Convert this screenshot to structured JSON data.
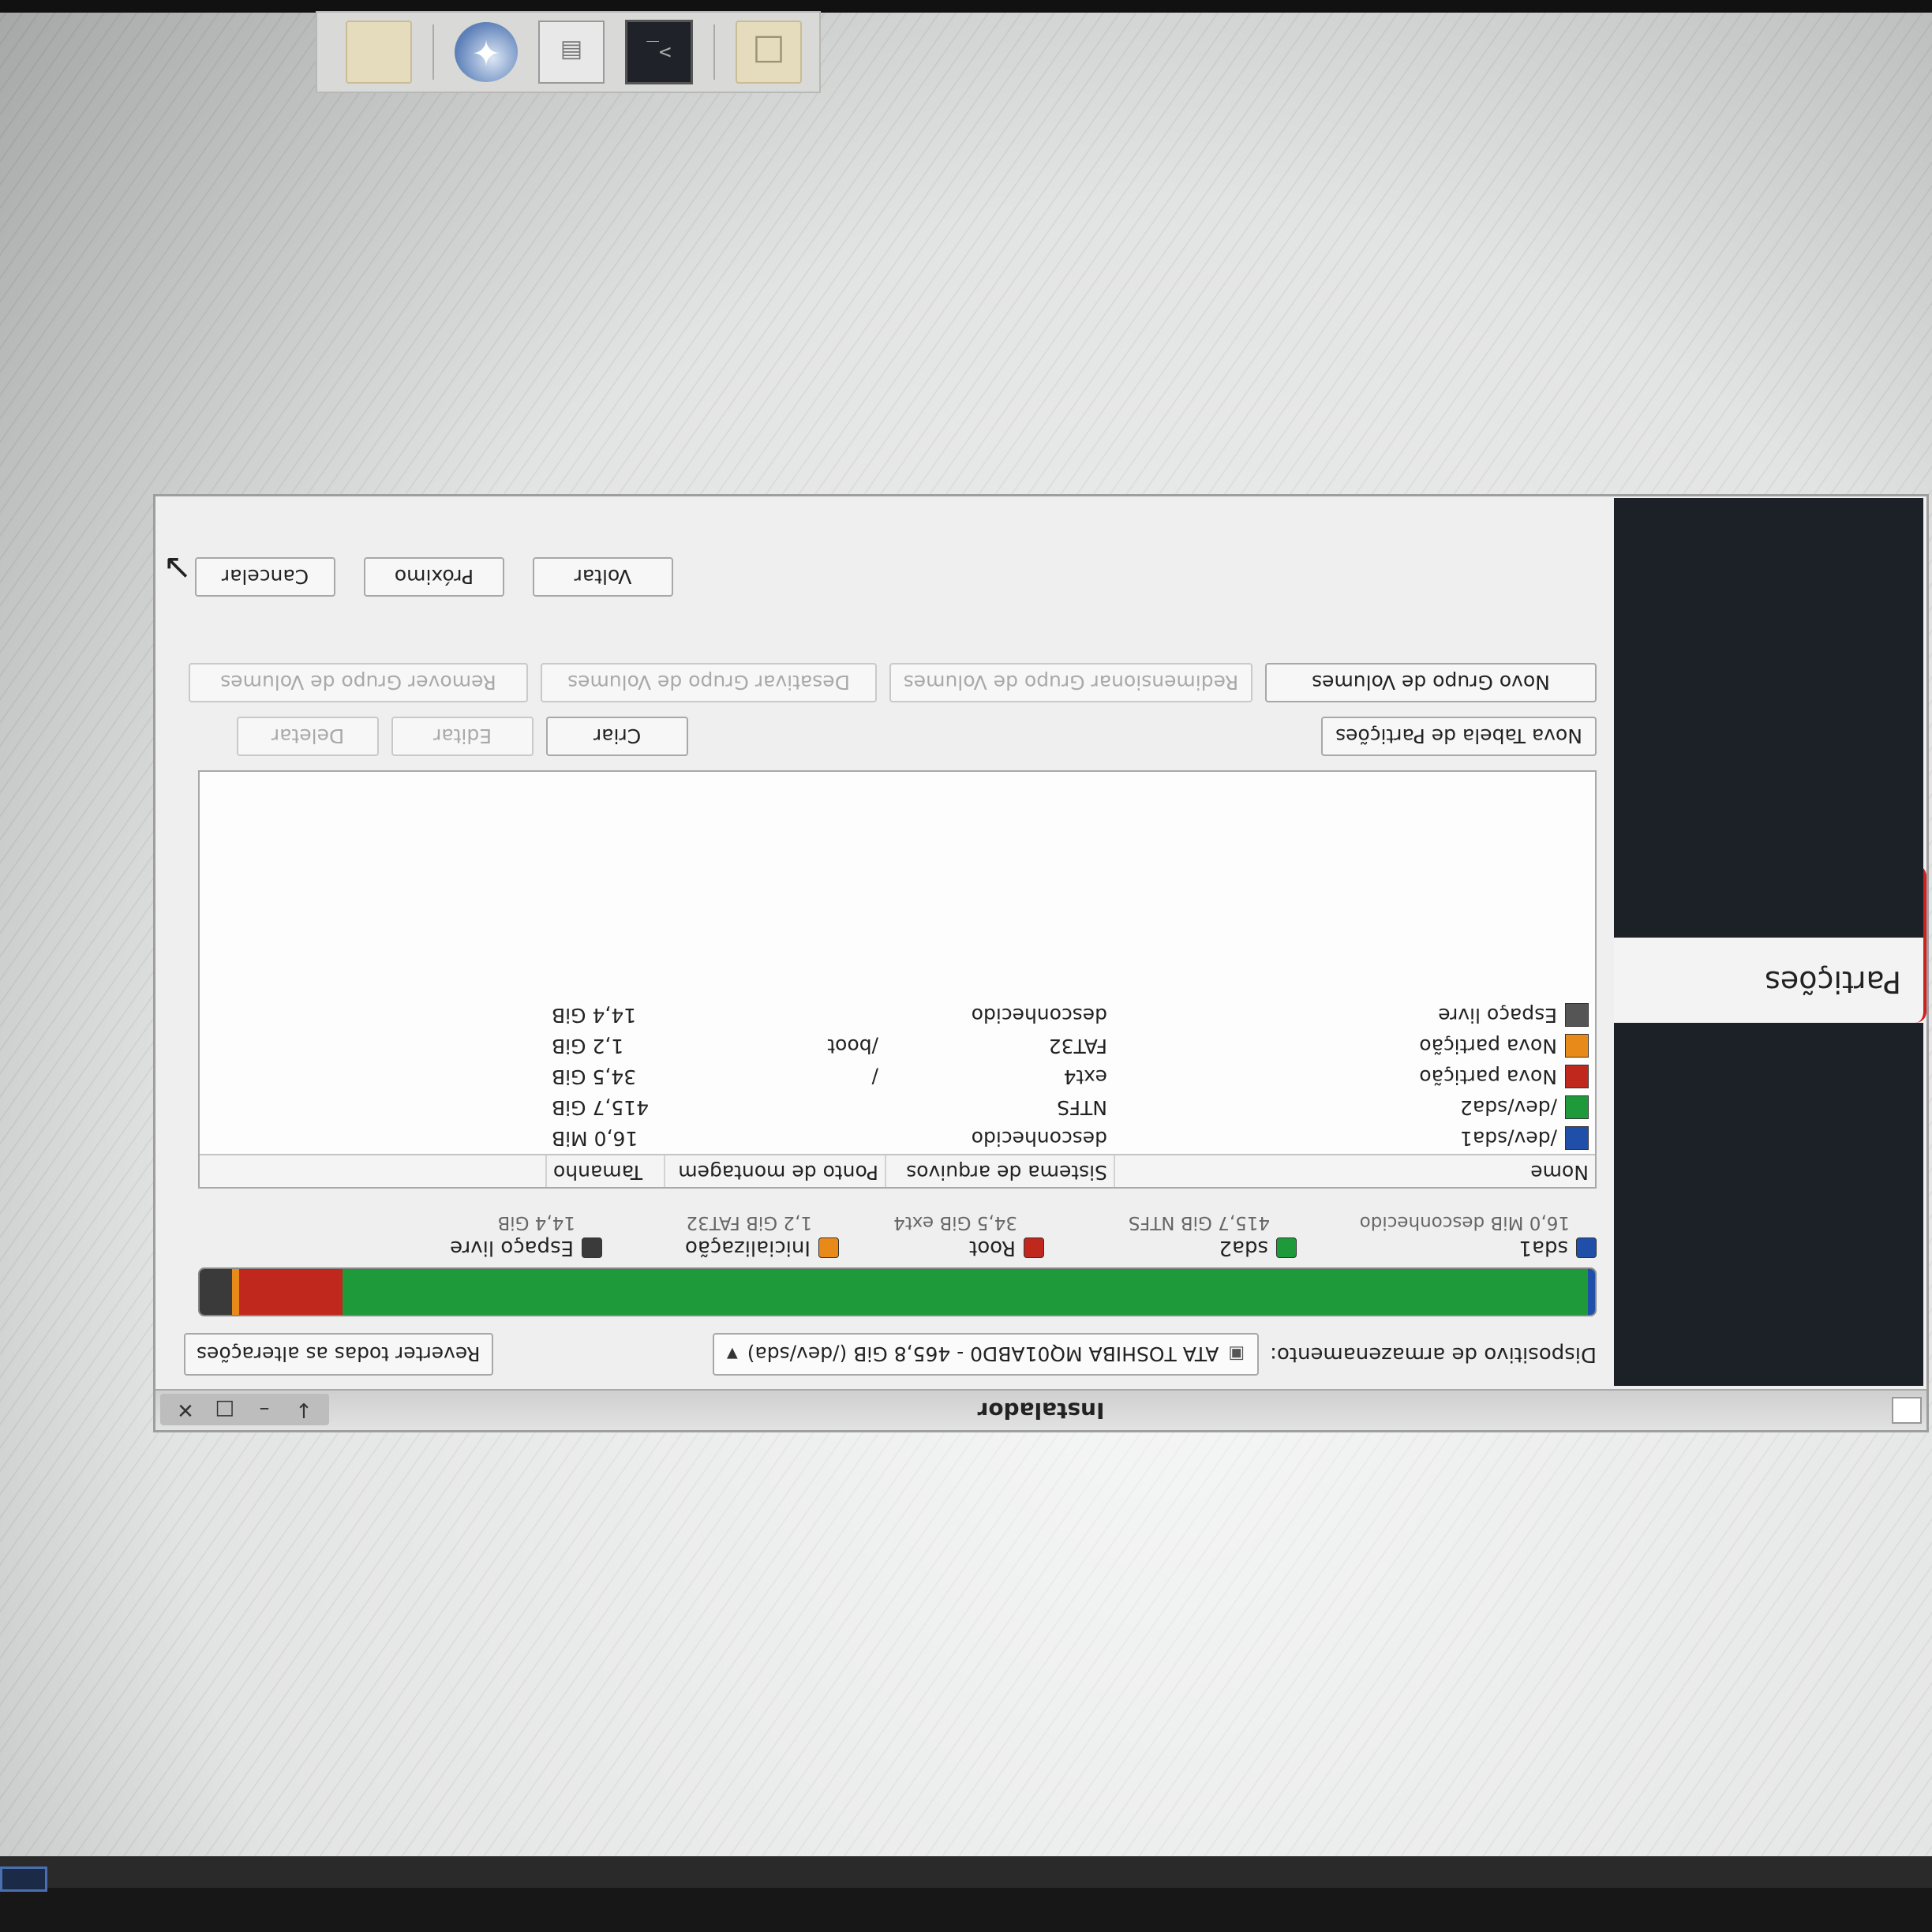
{
  "window": {
    "title": "Instalador"
  },
  "sidebar": {
    "title": "Partições"
  },
  "device": {
    "label": "Dispositivo de armazenamento:",
    "selected": "ATA TOSHIBA MQ01ABD0 - 465,8 GiB (/dev/sda)",
    "revert_label": "Reverter todas as alterações"
  },
  "usage": [
    {
      "name": "sda1",
      "fraction": 3e-05,
      "color": "#1f4fa8"
    },
    {
      "name": "sda2",
      "fraction": 0.8925,
      "color": "#1e9a3a"
    },
    {
      "name": "Root",
      "fraction": 0.0741,
      "color": "#c0281e"
    },
    {
      "name": "Inicialização",
      "fraction": 0.0026,
      "color": "#e88a1a"
    },
    {
      "name": "Espaço livre",
      "fraction": 0.0309,
      "color": "#3a3a3a"
    }
  ],
  "legend": [
    {
      "label": "sda1",
      "sub": "16,0 MiB  desconhecido",
      "color": "#1f4fa8"
    },
    {
      "label": "sda2",
      "sub": "415,7 GiB  NTFS",
      "color": "#1e9a3a"
    },
    {
      "label": "Root",
      "sub": "34,5 GiB  ext4",
      "color": "#c0281e"
    },
    {
      "label": "Inicialização",
      "sub": "1,2 GiB  FAT32",
      "color": "#e88a1a"
    },
    {
      "label": "Espaço livre",
      "sub": "14,4 GiB",
      "color": "#3a3a3a"
    }
  ],
  "table": {
    "headers": {
      "name": "Nome",
      "fs": "Sistema de arquivos",
      "mount": "Ponto de montagem",
      "size": "Tamanho"
    },
    "rows": [
      {
        "name": "/dev/sda1",
        "fs": "desconhecido",
        "mount": "",
        "size": "16,0 MiB",
        "color": "#1f4fa8"
      },
      {
        "name": "/dev/sda2",
        "fs": "NTFS",
        "mount": "",
        "size": "415,7 GiB",
        "color": "#1e9a3a"
      },
      {
        "name": "Nova partição",
        "fs": "ext4",
        "mount": "/",
        "size": "34,5 GiB",
        "color": "#c0281e"
      },
      {
        "name": "Nova partição",
        "fs": "FAT32",
        "mount": "/boot",
        "size": "1,2 GiB",
        "color": "#e88a1a"
      },
      {
        "name": "Espaço livre",
        "fs": "desconhecido",
        "mount": "",
        "size": "14,4 GiB",
        "color": "#555555"
      }
    ]
  },
  "buttons": {
    "new_table": "Nova Tabela de Partições",
    "create": "Criar",
    "edit": "Editar",
    "delete": "Deletar",
    "new_vg": "Novo Grupo de Volumes",
    "resize_vg": "Redimensionar Grupo de Volumes",
    "disable_vg": "Desativar Grupo de Volumes",
    "remove_vg": "Remover Grupo de Volumes",
    "back": "Voltar",
    "next": "Próximo",
    "cancel": "Cancelar"
  }
}
